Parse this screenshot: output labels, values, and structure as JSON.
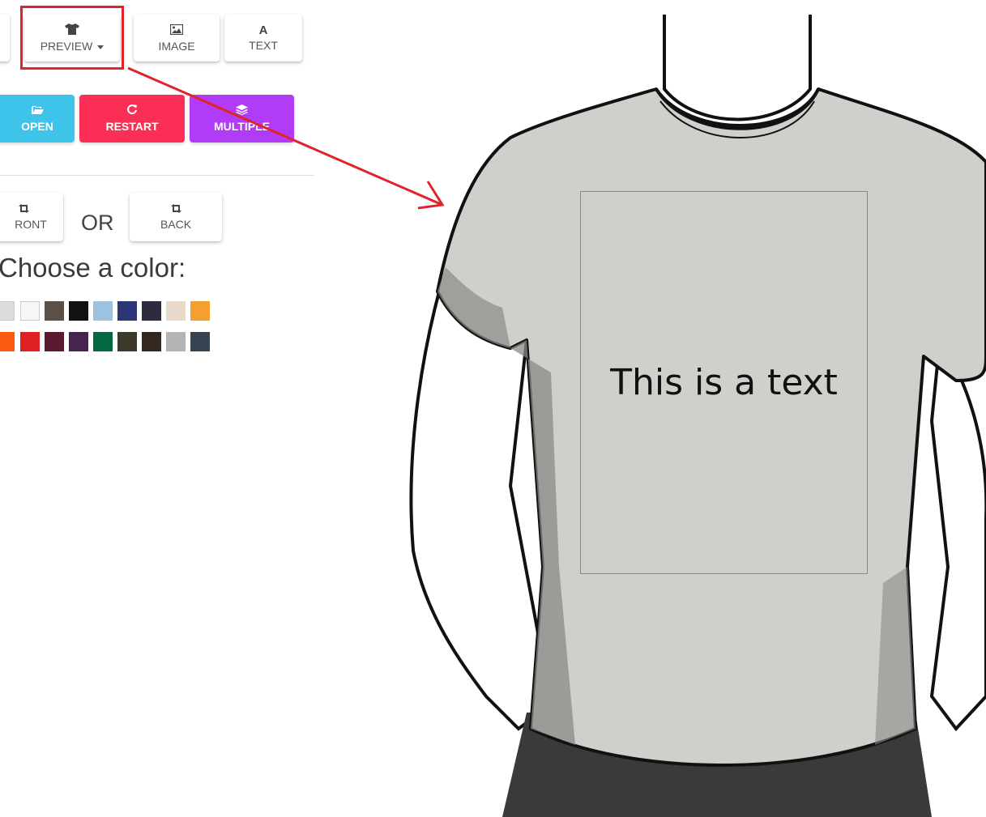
{
  "toolbar": {
    "preview_label": "PREVIEW",
    "image_label": "IMAGE",
    "text_label": "TEXT",
    "text_icon": "A"
  },
  "actions": {
    "open_label": "OPEN",
    "restart_label": "RESTART",
    "multiple_label": "MULTIPLE",
    "colors": {
      "open": "#3ec3ea",
      "restart": "#fb2e56",
      "multiple": "#b13cf7"
    }
  },
  "side": {
    "front_label": "RONT",
    "or_label": "OR",
    "back_label": "BACK"
  },
  "color_picker": {
    "title": "Choose a color:",
    "row1": [
      "#dcdcda",
      "#f6f6f6",
      "#5c4f4a",
      "#111111",
      "#9dc2dc",
      "#2c3677",
      "#2e2a3f",
      "#e8d8c8",
      "#f4a02e"
    ],
    "row2": [
      "#fb5a12",
      "#de1f23",
      "#5a1a32",
      "#472450",
      "#04673f",
      "#3d3a2c",
      "#32281f",
      "#b4b4b4",
      "#374452"
    ]
  },
  "canvas": {
    "shirt_color": "#cfd0cb",
    "print_text": "This is a text"
  },
  "annotation": {
    "color": "#e0242b"
  }
}
